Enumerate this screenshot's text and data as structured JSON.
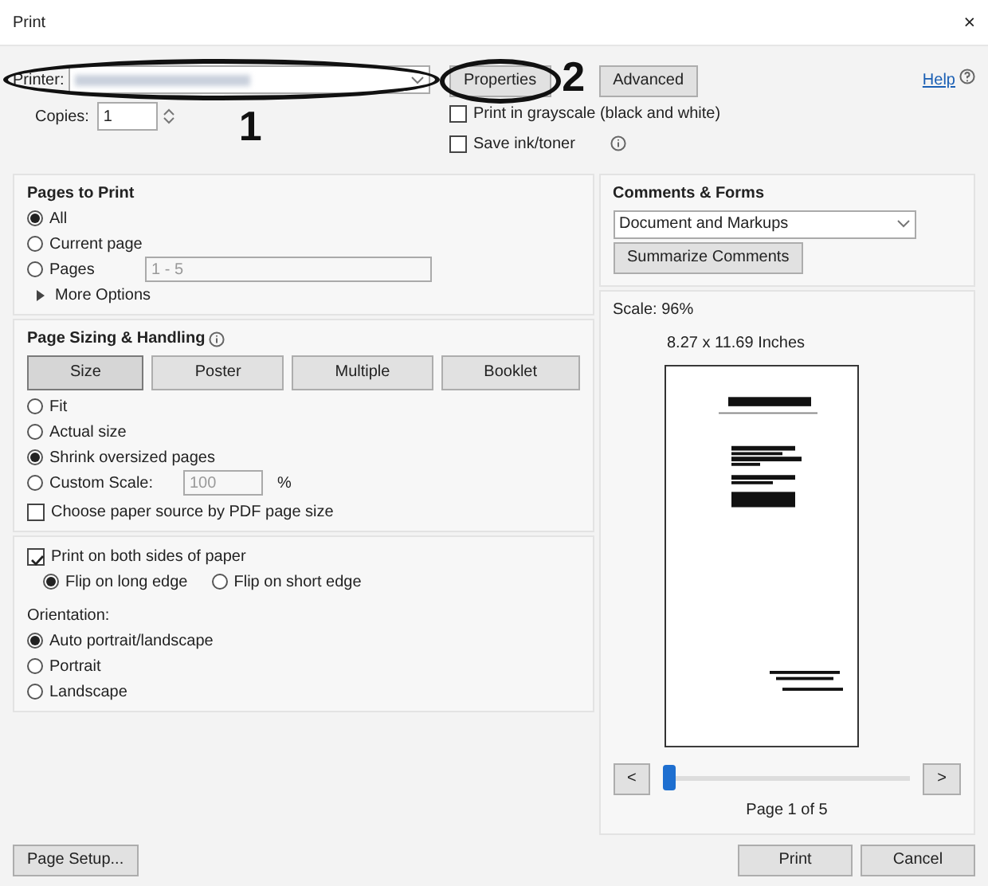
{
  "window": {
    "title": "Print",
    "close": "×"
  },
  "printer": {
    "label": "Printer:",
    "help": "Help"
  },
  "top_buttons": [
    {
      "label": "Properties"
    },
    {
      "label": "Advanced"
    }
  ],
  "copies": {
    "label": "Copies:",
    "value": "1"
  },
  "print_checks": [
    {
      "label": "Print in grayscale (black and white)",
      "checked": false
    },
    {
      "label": "Save ink/toner",
      "checked": false
    }
  ],
  "pages_to_print": {
    "title": "Pages to Print",
    "options": [
      {
        "label": "All",
        "selected": true
      },
      {
        "label": "Current page",
        "selected": false
      },
      {
        "label": "Pages",
        "selected": false,
        "placeholder": "1 - 5"
      }
    ],
    "more_options": "More Options"
  },
  "page_sizing": {
    "title": "Page Sizing & Handling",
    "tabs": [
      {
        "label": "Size",
        "selected": true
      },
      {
        "label": "Poster",
        "selected": false
      },
      {
        "label": "Multiple",
        "selected": false
      },
      {
        "label": "Booklet",
        "selected": false
      }
    ],
    "options": [
      {
        "label": "Fit",
        "selected": false
      },
      {
        "label": "Actual size",
        "selected": false
      },
      {
        "label": "Shrink oversized pages",
        "selected": true
      },
      {
        "label": "Custom Scale:",
        "selected": false,
        "placeholder": "100",
        "unit": "%"
      }
    ],
    "paper_source": {
      "label": "Choose paper source by PDF page size",
      "checked": false
    }
  },
  "duplex": {
    "label": "Print on both sides of paper",
    "checked": true,
    "options": [
      {
        "label": "Flip on long edge",
        "selected": true
      },
      {
        "label": "Flip on short edge",
        "selected": false
      }
    ]
  },
  "orientation": {
    "label": "Orientation:",
    "options": [
      {
        "label": "Auto portrait/landscape",
        "selected": true
      },
      {
        "label": "Portrait",
        "selected": false
      },
      {
        "label": "Landscape",
        "selected": false
      }
    ]
  },
  "comments_forms": {
    "title": "Comments & Forms",
    "value": "Document and Markups",
    "button": "Summarize Comments"
  },
  "preview": {
    "scale": "Scale: 96%",
    "size": "8.27 x 11.69 Inches",
    "prev": "<",
    "next": ">",
    "level": 0.0,
    "page": "Page 1 of 5"
  },
  "footer": {
    "page_setup": "Page Setup...",
    "print": "Print",
    "cancel": "Cancel"
  },
  "annotations": [
    {
      "label": "1"
    },
    {
      "label": "2"
    }
  ]
}
